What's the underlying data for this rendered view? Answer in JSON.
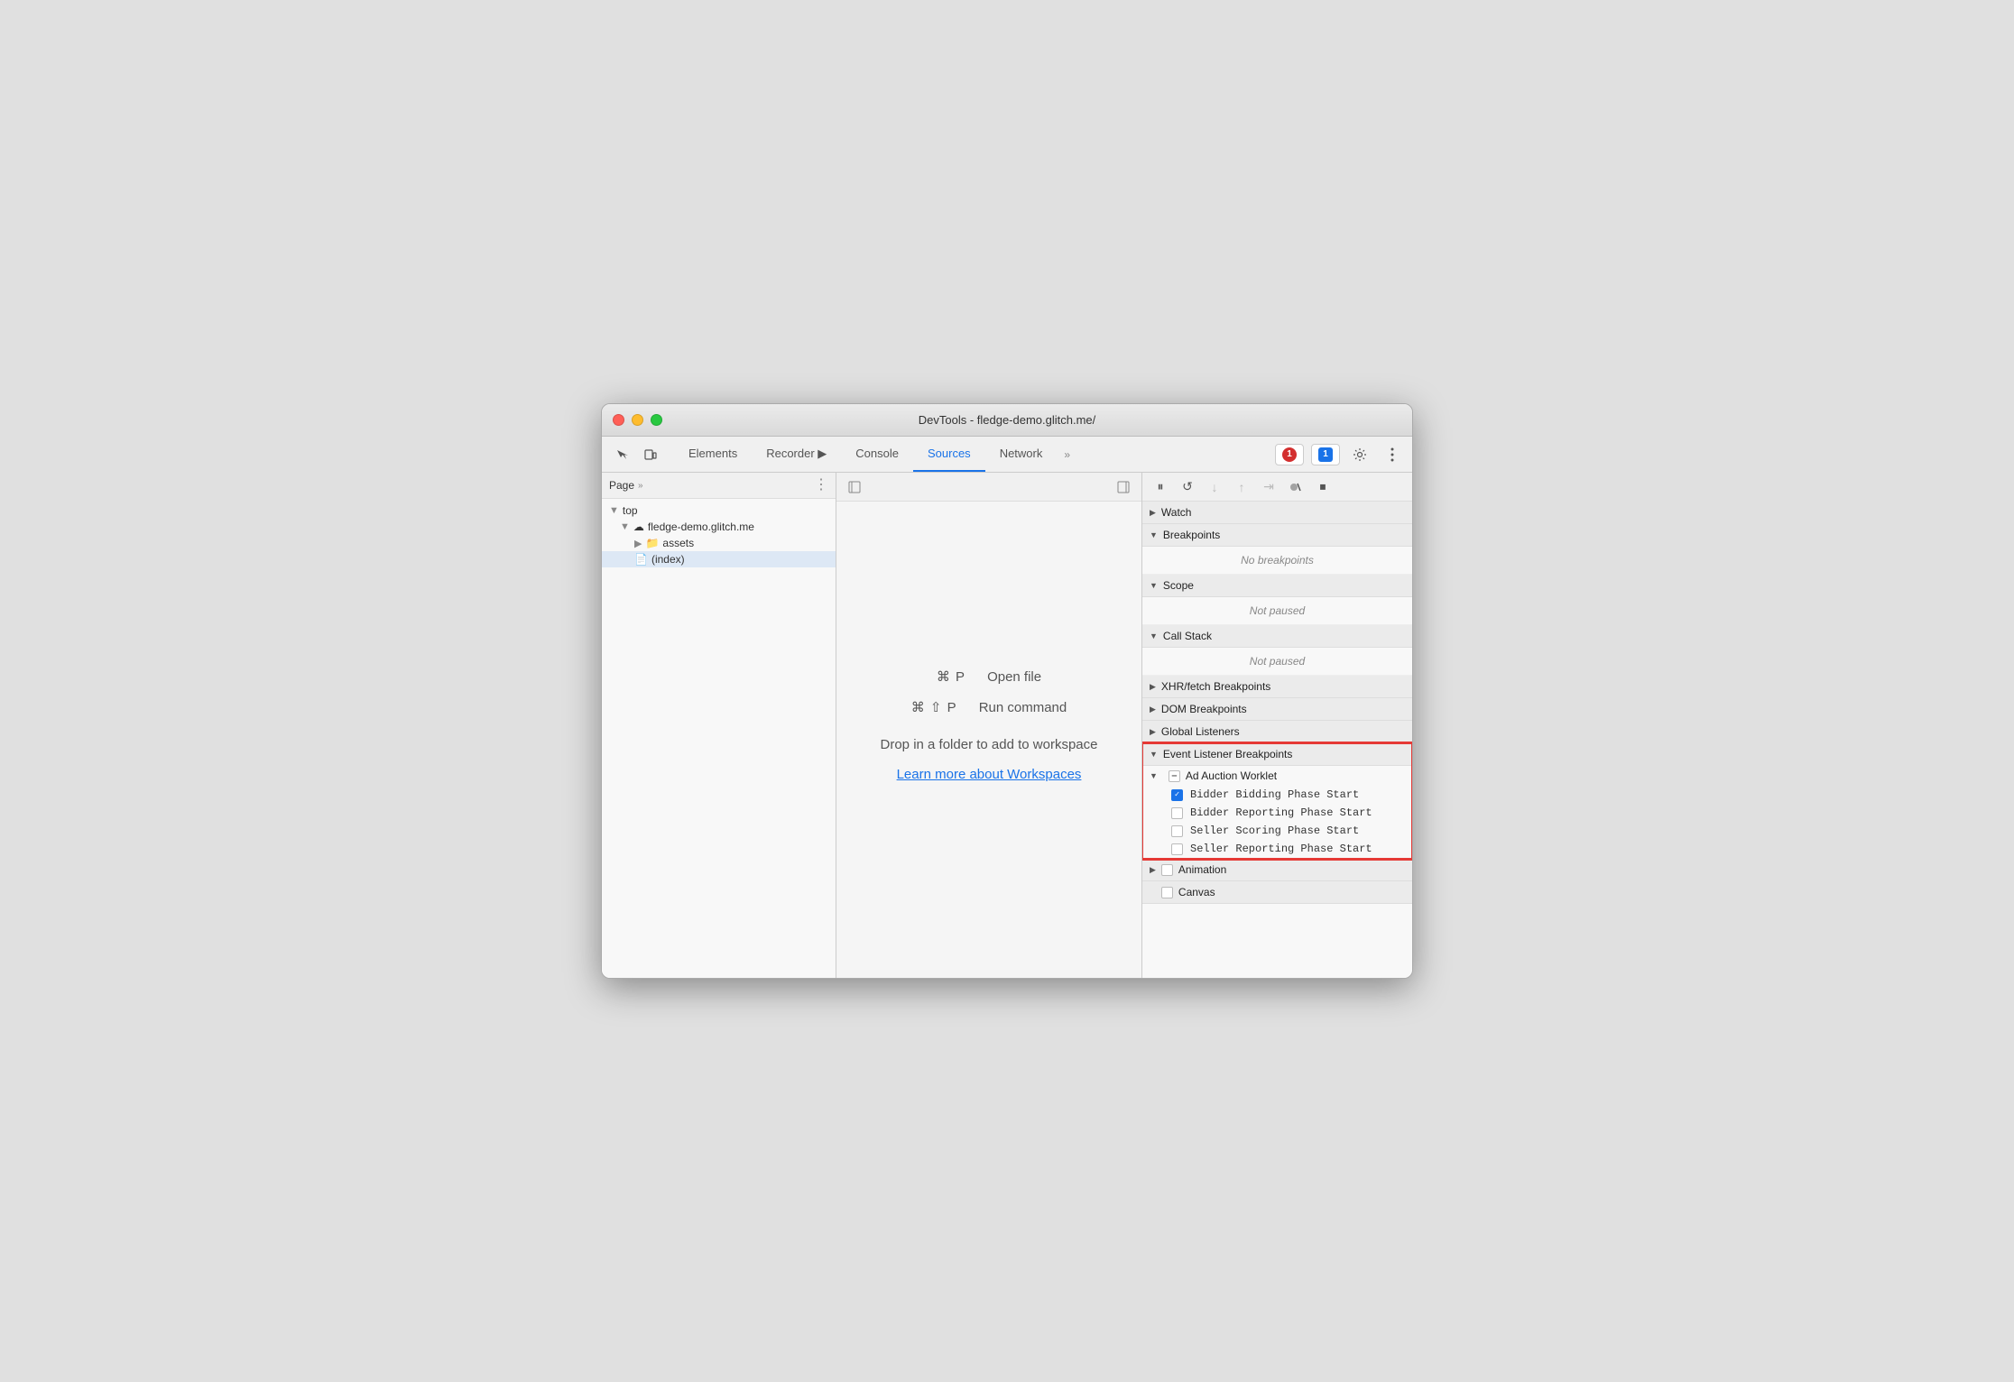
{
  "window": {
    "title": "DevTools - fledge-demo.glitch.me/"
  },
  "toolbar": {
    "tabs": [
      {
        "id": "elements",
        "label": "Elements",
        "active": false
      },
      {
        "id": "recorder",
        "label": "Recorder 🎙",
        "active": false
      },
      {
        "id": "console",
        "label": "Console",
        "active": false
      },
      {
        "id": "sources",
        "label": "Sources",
        "active": true
      },
      {
        "id": "network",
        "label": "Network",
        "active": false
      }
    ],
    "more_tabs_label": "»",
    "error_count": "1",
    "info_count": "1"
  },
  "left_panel": {
    "header_label": "Page",
    "header_chevron": "»",
    "tree": [
      {
        "id": "top",
        "label": "top",
        "indent": 0,
        "type": "arrow-open"
      },
      {
        "id": "fledge-demo",
        "label": "fledge-demo.glitch.me",
        "indent": 1,
        "type": "cloud"
      },
      {
        "id": "assets",
        "label": "assets",
        "indent": 2,
        "type": "folder"
      },
      {
        "id": "index",
        "label": "(index)",
        "indent": 2,
        "type": "file",
        "selected": true
      }
    ]
  },
  "middle_panel": {
    "shortcut1_keys": "⌘ P",
    "shortcut1_label": "Open file",
    "shortcut2_keys": "⌘ ⇧ P",
    "shortcut2_label": "Run command",
    "drop_text": "Drop in a folder to add to workspace",
    "workspace_link": "Learn more about Workspaces"
  },
  "right_panel": {
    "sections": [
      {
        "id": "watch",
        "label": "Watch",
        "collapsed": true
      },
      {
        "id": "breakpoints",
        "label": "Breakpoints",
        "collapsed": false,
        "body": "No breakpoints",
        "body_style": "italic"
      },
      {
        "id": "scope",
        "label": "Scope",
        "collapsed": false,
        "body": "Not paused"
      },
      {
        "id": "call-stack",
        "label": "Call Stack",
        "collapsed": false,
        "body": "Not paused"
      },
      {
        "id": "xhr-breakpoints",
        "label": "XHR/fetch Breakpoints",
        "collapsed": true
      },
      {
        "id": "dom-breakpoints",
        "label": "DOM Breakpoints",
        "collapsed": true
      },
      {
        "id": "global-listeners",
        "label": "Global Listeners",
        "collapsed": true
      },
      {
        "id": "event-listener-breakpoints",
        "label": "Event Listener Breakpoints",
        "collapsed": false,
        "highlighted": true
      }
    ],
    "event_listener_groups": [
      {
        "id": "ad-auction-worklet",
        "label": "Ad Auction Worklet",
        "state": "minus",
        "items": [
          {
            "id": "bidder-bidding",
            "label": "Bidder Bidding Phase Start",
            "checked": true
          },
          {
            "id": "bidder-reporting",
            "label": "Bidder Reporting Phase Start",
            "checked": false
          },
          {
            "id": "seller-scoring",
            "label": "Seller Scoring Phase Start",
            "checked": false
          },
          {
            "id": "seller-reporting",
            "label": "Seller Reporting Phase Start",
            "checked": false
          }
        ]
      },
      {
        "id": "animation",
        "label": "Animation",
        "state": "unchecked",
        "items": []
      },
      {
        "id": "canvas",
        "label": "Canvas",
        "state": "unchecked",
        "items": []
      }
    ]
  }
}
